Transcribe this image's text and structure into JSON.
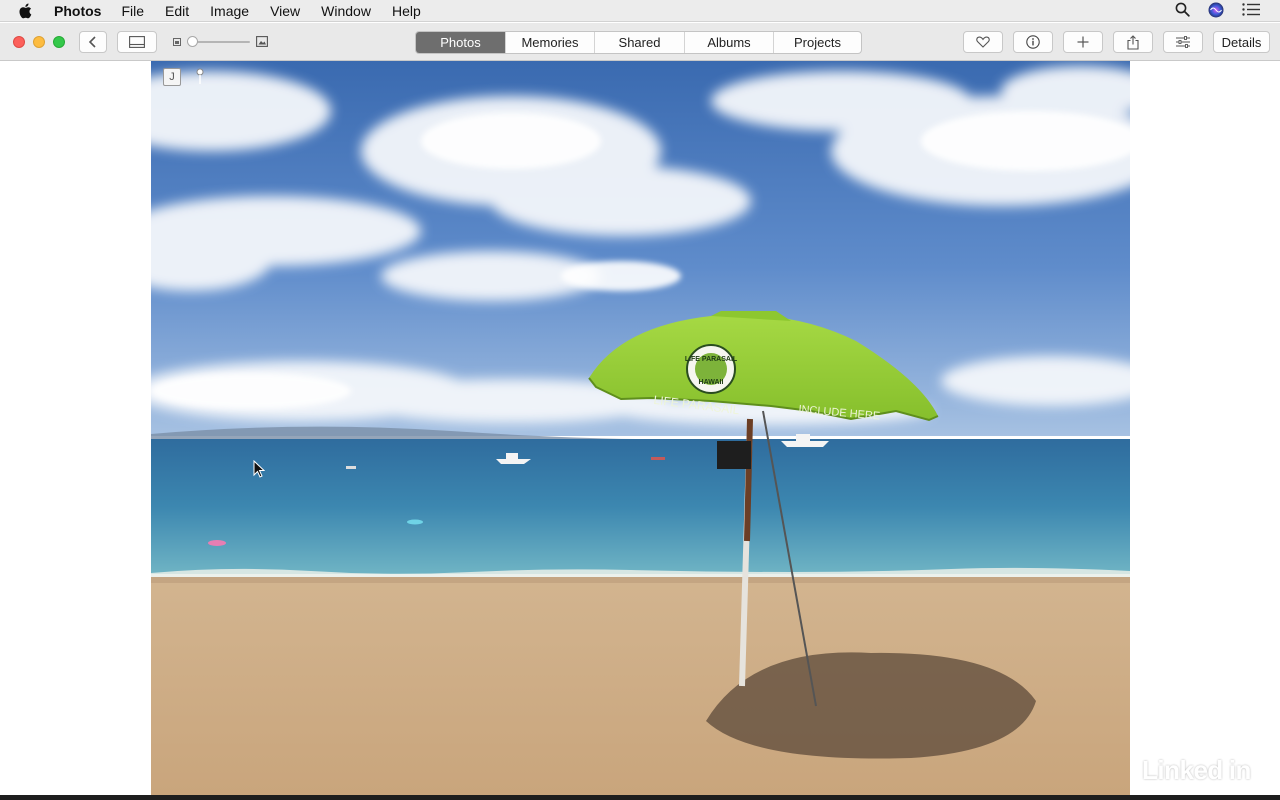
{
  "menubar": {
    "app_name": "Photos",
    "items": [
      "File",
      "Edit",
      "Image",
      "View",
      "Window",
      "Help"
    ],
    "icons": [
      "apple-logo",
      "search-icon",
      "siri-icon",
      "notification-center-icon"
    ]
  },
  "toolbar": {
    "tabs": [
      {
        "label": "Photos",
        "active": true
      },
      {
        "label": "Memories",
        "active": false
      },
      {
        "label": "Shared",
        "active": false
      },
      {
        "label": "Albums",
        "active": false
      },
      {
        "label": "Projects",
        "active": false
      }
    ],
    "details_label": "Details",
    "icons": [
      "back-icon",
      "sidebar-icon",
      "zoom-slider",
      "favorite-heart-icon",
      "info-icon",
      "add-icon",
      "share-icon",
      "adjust-icon"
    ],
    "zoom_level": 0.0
  },
  "photo": {
    "subject": "Beach umbrella on sand with ocean and cloudy sky",
    "badge_letter": "J",
    "umbrella_text_1": "LIFE PARASAIL",
    "umbrella_text_2": "INCLUDE HERE",
    "umbrella_logo_top": "LIFE PARASAIL",
    "umbrella_logo_bottom": "HAWAII",
    "colors": {
      "sky_top": "#3d6fb4",
      "sky_bottom": "#8fb2dc",
      "ocean": "#3f83ad",
      "sand": "#cfae86",
      "umbrella": "#9fd33a"
    }
  },
  "watermark": {
    "part1": "Linked",
    "part2": "in"
  }
}
